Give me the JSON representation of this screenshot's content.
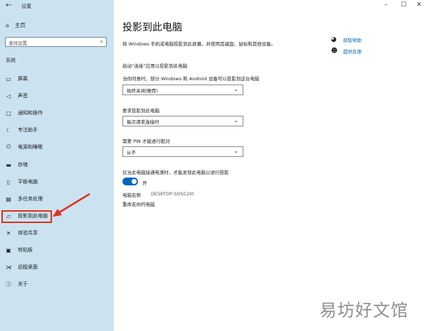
{
  "window": {
    "title": "设置",
    "back_icon": "arrow-left-icon",
    "minimize": "–",
    "maximize": "☐",
    "close": "✕"
  },
  "sidebar": {
    "home_label": "主页",
    "search_placeholder": "查找设置",
    "section_label": "系统",
    "items": [
      {
        "label": "屏幕",
        "icon": "monitor-icon"
      },
      {
        "label": "声音",
        "icon": "speaker-icon"
      },
      {
        "label": "通知和操作",
        "icon": "notification-icon"
      },
      {
        "label": "专注助手",
        "icon": "moon-icon"
      },
      {
        "label": "电源和睡眠",
        "icon": "power-icon"
      },
      {
        "label": "存储",
        "icon": "storage-icon"
      },
      {
        "label": "平板电脑",
        "icon": "tablet-icon"
      },
      {
        "label": "多任务处理",
        "icon": "multitask-icon"
      },
      {
        "label": "投影到此电脑",
        "icon": "project-icon"
      },
      {
        "label": "体验共享",
        "icon": "share-icon"
      },
      {
        "label": "剪贴板",
        "icon": "clipboard-icon"
      },
      {
        "label": "远程桌面",
        "icon": "remote-icon"
      },
      {
        "label": "关于",
        "icon": "info-icon"
      }
    ]
  },
  "main": {
    "title": "投影到此电脑",
    "description": "将 Windows 手机或电脑投影到此屏幕，并使用其键盘、鼠标和其他设备。",
    "launch_link": "启动“连接”应用以投影到此电脑",
    "setting1": {
      "label": "当你同意时，部分 Windows 和 Android 设备可以投影到这台电脑",
      "value": "始终关闭(推荐)"
    },
    "setting2": {
      "label": "要求投影到此电脑",
      "value": "每次请求连接时"
    },
    "setting3": {
      "label": "需要 PIN 才能进行配对",
      "value": "从不"
    },
    "power_label": "仅当此电脑接通电源时，才能发现此电脑以进行投影",
    "toggle_state": "开",
    "pc_name_label": "电脑名称",
    "pc_name_value": "DESKTOP-SOSC2I0",
    "rename_link": "重命名你的电脑"
  },
  "related": {
    "help": "获取帮助",
    "feedback": "提供反馈"
  },
  "watermark": "易坊好文馆",
  "colors": {
    "sidebar_bg": "#cbe3f0",
    "accent": "#0067c0",
    "highlight": "#e0301e"
  }
}
